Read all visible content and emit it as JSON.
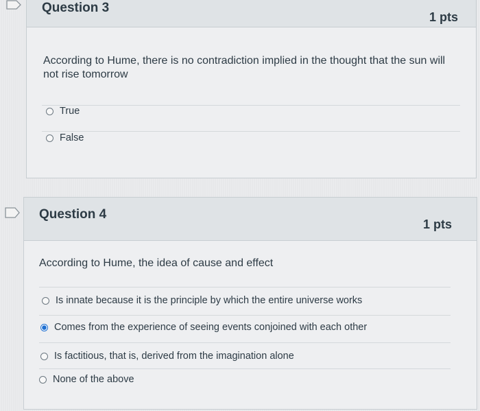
{
  "questions": [
    {
      "title": "Question 3",
      "points": "1 pts",
      "text": "According to Hume, there is no contradiction implied in the thought that the sun will not rise tomorrow",
      "answers": [
        {
          "label": "True",
          "selected": false
        },
        {
          "label": "False",
          "selected": false
        }
      ]
    },
    {
      "title": "Question 4",
      "points": "1 pts",
      "text": "According to Hume, the idea of cause and effect",
      "answers": [
        {
          "label": "Is innate because it is the principle by which the entire universe works",
          "selected": false
        },
        {
          "label": "Comes from the experience of seeing events conjoined with each other",
          "selected": true
        },
        {
          "label": "Is factitious, that is, derived from the imagination alone",
          "selected": false
        },
        {
          "label": "None of the above",
          "selected": false
        }
      ]
    }
  ],
  "colors": {
    "accent": "#1e6fd1",
    "text": "#2d3b45",
    "header_bg": "#dfe3e6"
  },
  "icons": [
    "flag-icon",
    "radio-unchecked-icon",
    "radio-checked-icon"
  ]
}
